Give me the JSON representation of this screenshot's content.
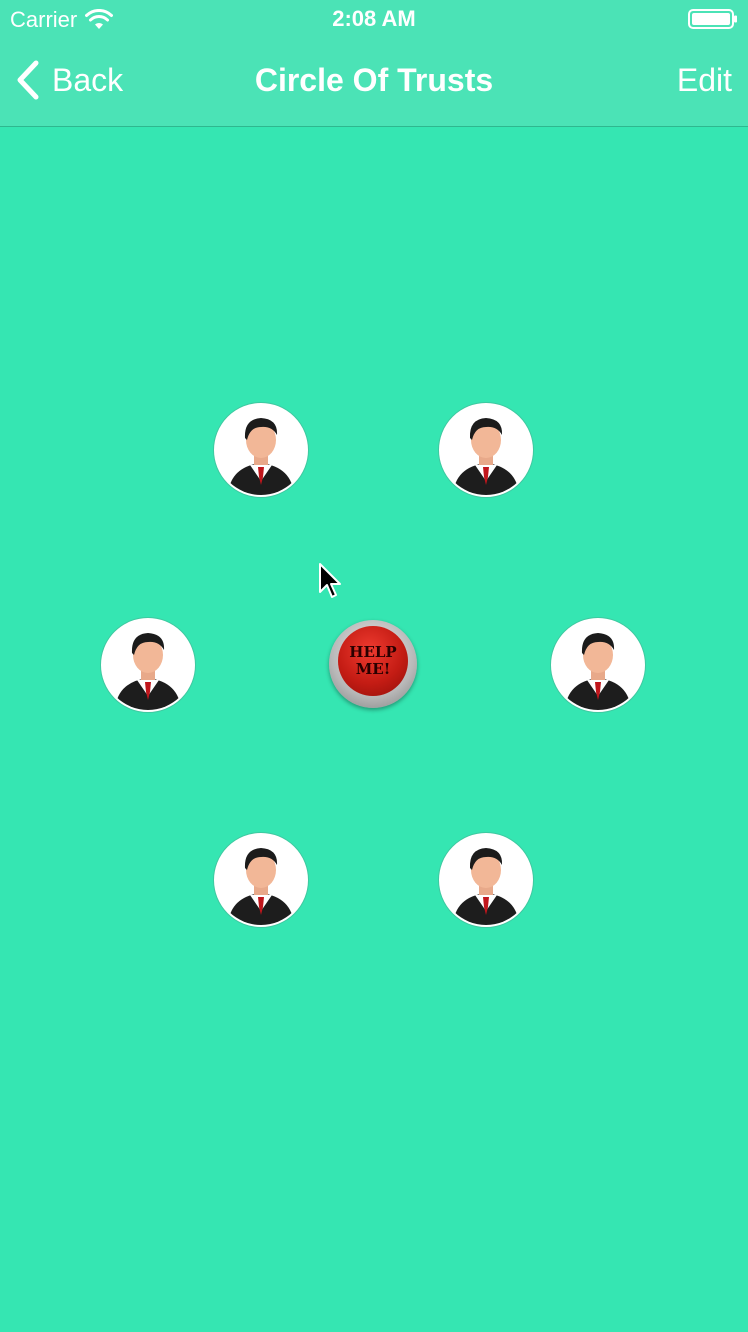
{
  "status_bar": {
    "carrier": "Carrier",
    "time": "2:08 AM"
  },
  "nav": {
    "back_label": "Back",
    "title": "Circle Of Trusts",
    "edit_label": "Edit"
  },
  "help_button": {
    "line1": "HELP",
    "line2": "ME!"
  },
  "colors": {
    "background": "#35e6b2",
    "nav_background": "#4be3b6",
    "help_red": "#c41c14"
  },
  "icons": {
    "contact": "person-in-suit-icon",
    "back": "chevron-left-icon",
    "wifi": "wifi-icon",
    "battery": "battery-icon"
  }
}
